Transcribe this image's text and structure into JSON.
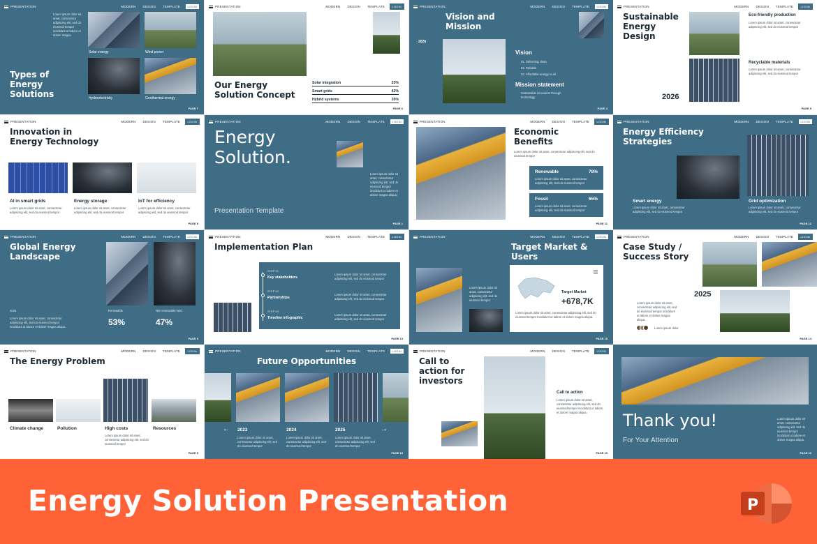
{
  "nav": {
    "brand": "PRESENTATION",
    "links": [
      "MODERN",
      "DESIGN",
      "TEMPLATE"
    ],
    "login": "LOGIN"
  },
  "lorem2": "Lorem ipsum dolor sit amet, consectetur adipiscing elit, sed do eiusmod tempor",
  "lorem3": "Lorem ipsum dolor sit amet, consectetur adipiscing elit, sed do eiusmod tempor incididunt ut labore et dolore magna aliqua.",
  "s1": {
    "title": "Types of Energy Solutions",
    "lorem": "Lorem ipsum dolor sit amet, consectetur adipiscing elit, sed do eiusmod tempor incididunt ut labore et dolore magna",
    "caps": [
      "Solar energy",
      "Wind power",
      "Hydroelectricity",
      "Geothermal energy"
    ],
    "page": "PAGE 7"
  },
  "s2": {
    "title": "Our Energy Solution Concept",
    "rows": [
      {
        "k": "Solar integration",
        "v": "23%"
      },
      {
        "k": "Smart grids",
        "v": "42%"
      },
      {
        "k": "Hybrid systems",
        "v": "35%"
      }
    ],
    "page": "PAGE 6"
  },
  "s3": {
    "title": "Vision and Mission",
    "year": "2026",
    "vision": "Vision",
    "items": [
      "01.   Delivering clean",
      "02.   Reliable",
      "03.   Affordable energy to all"
    ],
    "mission": "Mission statement",
    "mission_text": "Sustainable innovation through technology",
    "page": "PAGE 4"
  },
  "s4": {
    "title": "Sustainable Energy Design",
    "year": "2026",
    "h1": "Eco-friendly production",
    "h2": "Recyclable materials",
    "page": "PAGE 9"
  },
  "s5": {
    "title": "Innovation in Energy Technology",
    "items": [
      "AI in smart grids",
      "Energy storage",
      "IoT for efficiency"
    ],
    "page": "PAGE 8"
  },
  "s6": {
    "title": "Energy Solution.",
    "subtitle": "Presentation Template",
    "page": "PAGE 1"
  },
  "s7": {
    "title": "Economic Benefits",
    "b1": {
      "k": "Renewable",
      "v": "78%"
    },
    "b2": {
      "k": "Fossil",
      "v": "65%"
    },
    "page": "PAGE 11"
  },
  "s8": {
    "title": "Energy Efficiency Strategies",
    "c1": "Smart energy",
    "c2": "Grid optimization",
    "page": "PAGE 12"
  },
  "s9": {
    "title": "Global Energy Landscape",
    "year": "2025",
    "c1": "Renewable",
    "c2": "Non-renewable ratio",
    "v1": "53%",
    "v2": "47%",
    "page": "PAGE 3"
  },
  "s10": {
    "title": "Implementation Plan",
    "steps": [
      {
        "n": "STEP 01",
        "t": "Key stakeholders"
      },
      {
        "n": "STEP 02",
        "t": "Partnerships"
      },
      {
        "n": "STEP 03",
        "t": "Timeline infographic"
      }
    ],
    "page": "PAGE 13"
  },
  "s11": {
    "title": "Target Market & Users",
    "card_label": "Target Market",
    "card_value": "+678,7K",
    "page": "PAGE 15"
  },
  "s12": {
    "title": "Case Study / Success Story",
    "year": "2025",
    "avatar_text": "Lorem ipsum dolor",
    "page": "PAGE 14"
  },
  "s13": {
    "title": "The Energy Problem",
    "items": [
      "Climate change",
      "Pollution",
      "High costs",
      "Resources"
    ],
    "page": "PAGE 5"
  },
  "s14": {
    "title": "Future Opportunities",
    "years": [
      "2023",
      "2024",
      "2025"
    ],
    "page": "PAGE 15"
  },
  "s15": {
    "title": "Call to action for investors",
    "h": "Call to action",
    "page": "PAGE 19"
  },
  "s16": {
    "title": "Thank you!",
    "subtitle": "For Your Attention",
    "page": "PAGE 20"
  },
  "banner": {
    "title": "Energy Solution Presentation",
    "logo_letter": "P",
    "logo_icon": "powerpoint-icon"
  },
  "colors": {
    "teal": "#3f6d86",
    "orange": "#ff6236",
    "dark": "#1e2a33"
  }
}
